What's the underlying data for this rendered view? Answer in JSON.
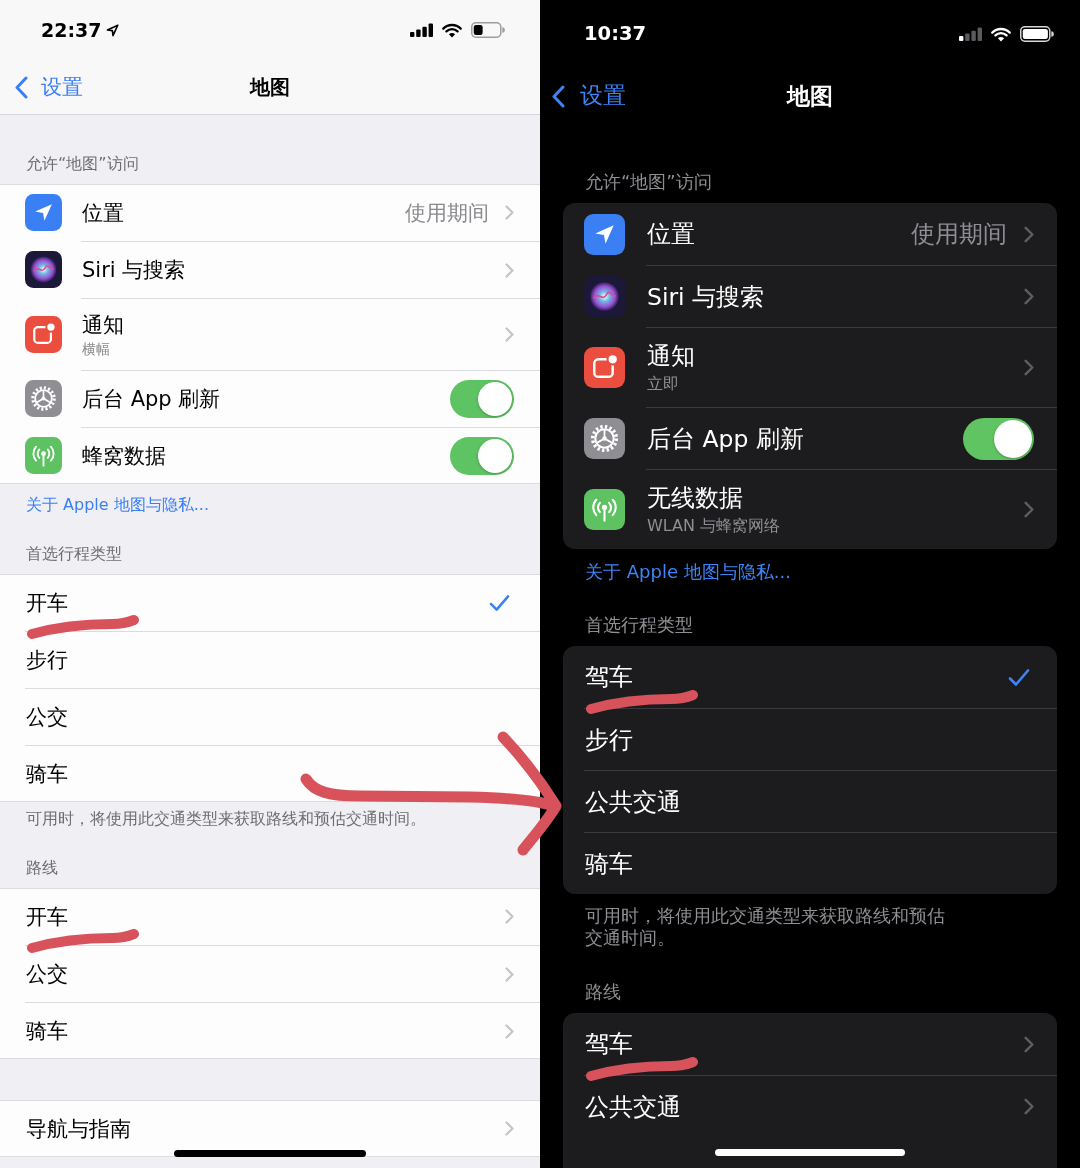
{
  "screens": [
    {
      "kind": "light",
      "status_bar": {
        "time": "22:37",
        "location_active": true
      },
      "nav": {
        "back": "设置",
        "title": "地图"
      },
      "groups": [
        {
          "kind": "icons",
          "header": "允许“地图”访问",
          "rows": [
            {
              "kind": "link",
              "label": "位置",
              "value": "使用期间"
            },
            {
              "kind": "link",
              "label": "Siri 与搜索"
            },
            {
              "kind": "link",
              "label": "通知",
              "subtitle": "横幅"
            },
            {
              "kind": "toggle",
              "label": "后台 App 刷新",
              "on": true
            },
            {
              "kind": "toggle",
              "label": "蜂窝数据",
              "on": true
            }
          ],
          "link": "关于 Apple 地图与隐私..."
        },
        {
          "kind": "plain",
          "header": "首选行程类型",
          "rows": [
            {
              "kind": "choice",
              "label": "开车",
              "selected": true,
              "underlined": true
            },
            {
              "kind": "choice",
              "label": "步行",
              "selected": false,
              "underlined": false
            },
            {
              "kind": "choice",
              "label": "公交",
              "selected": false,
              "underlined": false
            },
            {
              "kind": "choice",
              "label": "骑车",
              "selected": false,
              "underlined": false
            }
          ],
          "footer": "可用时，将使用此交通类型来获取路线和预估交通时间。"
        },
        {
          "kind": "plain",
          "header": "路线",
          "rows": [
            {
              "kind": "link",
              "label": "开车",
              "underlined": true
            },
            {
              "kind": "link",
              "label": "公交",
              "underlined": false
            },
            {
              "kind": "link",
              "label": "骑车",
              "underlined": false
            }
          ]
        },
        {
          "kind": "plain",
          "rows": [
            {
              "kind": "link",
              "label": "导航与指南"
            }
          ]
        }
      ]
    },
    {
      "kind": "dark",
      "status_bar": {
        "time": "10:37",
        "location_active": false
      },
      "nav": {
        "back": "设置",
        "title": "地图"
      },
      "groups": [
        {
          "kind": "icons",
          "header": "允许“地图”访问",
          "rows": [
            {
              "kind": "link",
              "label": "位置",
              "value": "使用期间"
            },
            {
              "kind": "link",
              "label": "Siri 与搜索"
            },
            {
              "kind": "link",
              "label": "通知",
              "subtitle": "立即"
            },
            {
              "kind": "toggle",
              "label": "后台 App 刷新",
              "on": true
            },
            {
              "kind": "link",
              "label": "无线数据",
              "subtitle": "WLAN 与蜂窝网络"
            }
          ],
          "link": "关于 Apple 地图与隐私..."
        },
        {
          "kind": "plain",
          "header": "首选行程类型",
          "rows": [
            {
              "kind": "choice",
              "label": "驾车",
              "selected": true,
              "underlined": true
            },
            {
              "kind": "choice",
              "label": "步行",
              "selected": false,
              "underlined": false
            },
            {
              "kind": "choice",
              "label": "公共交通",
              "selected": false,
              "underlined": false
            },
            {
              "kind": "choice",
              "label": "骑车",
              "selected": false,
              "underlined": false
            }
          ],
          "footer": "可用时，将使用此交通类型来获取路线和预估交通时间。"
        },
        {
          "kind": "plain",
          "header": "路线",
          "rows": [
            {
              "kind": "link",
              "label": "驾车",
              "underlined": true
            },
            {
              "kind": "link",
              "label": "公共交通",
              "underlined": false
            }
          ]
        }
      ]
    }
  ],
  "annotation_arrow": true
}
